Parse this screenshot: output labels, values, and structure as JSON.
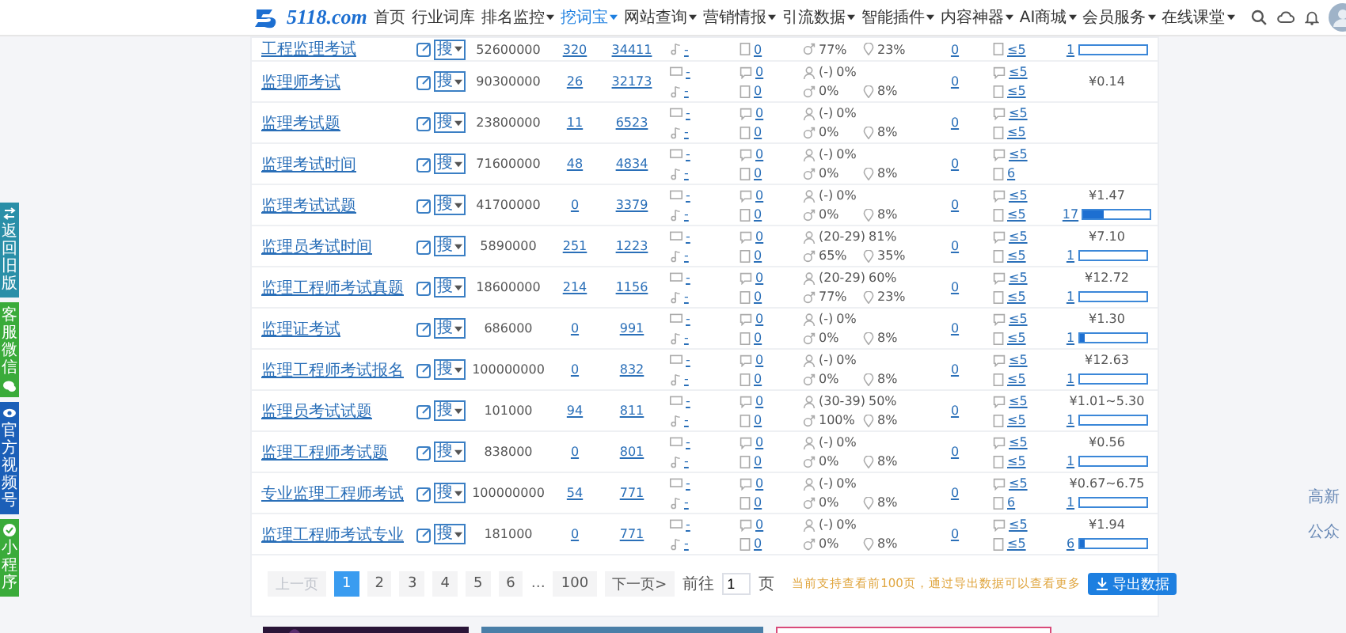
{
  "header": {
    "logo": "5118.com",
    "nav": [
      {
        "label": "首页",
        "dropdown": false,
        "selected": false
      },
      {
        "label": "行业词库",
        "dropdown": false,
        "selected": false
      },
      {
        "label": "排名监控",
        "dropdown": true,
        "selected": false
      },
      {
        "label": "挖词宝",
        "dropdown": true,
        "selected": true
      },
      {
        "label": "网站查询",
        "dropdown": true,
        "selected": false
      },
      {
        "label": "营销情报",
        "dropdown": true,
        "selected": false
      },
      {
        "label": "引流数据",
        "dropdown": true,
        "selected": false
      },
      {
        "label": "智能插件",
        "dropdown": true,
        "selected": false
      },
      {
        "label": "内容神器",
        "dropdown": true,
        "selected": false
      },
      {
        "label": "AI商城",
        "dropdown": true,
        "selected": false
      },
      {
        "label": "会员服务",
        "dropdown": true,
        "selected": false
      },
      {
        "label": "在线课堂",
        "dropdown": true,
        "selected": false
      }
    ]
  },
  "side_tabs": [
    {
      "label": "返回旧版",
      "color": "#2a8fa8",
      "kind": "back"
    },
    {
      "label": "客服微信",
      "color": "#3aab3a",
      "kind": "wechat"
    },
    {
      "label": "官方视频号",
      "color": "#1b5fb8",
      "kind": "video"
    },
    {
      "label": "小程序",
      "color": "#3aab3a",
      "kind": "miniapp"
    }
  ],
  "rows": [
    {
      "keyword": "工程监理考试",
      "tool": "搜",
      "index": "52600000",
      "col3": "320",
      "col4": "34411",
      "col8": "0",
      "bottom": {
        "col5": "-",
        "col6": "0",
        "male": "77%",
        "region": "23%",
        "col9": "≤5",
        "count": "1",
        "level": 0
      }
    },
    {
      "keyword": "监理师考试",
      "tool": "搜",
      "index": "90300000",
      "col3": "26",
      "col4": "32173",
      "col8": "0",
      "top": {
        "col5": "-",
        "col6": "0",
        "age": "(-)",
        "age_share": "0%",
        "col9": "≤5",
        "price": "¥0.14"
      },
      "bottom": {
        "col5": "-",
        "col6": "0",
        "male": "0%",
        "region": "8%",
        "col9": "≤5"
      }
    },
    {
      "keyword": "监理考试题",
      "tool": "搜",
      "index": "23800000",
      "col3": "11",
      "col4": "6523",
      "col8": "0",
      "top": {
        "col5": "-",
        "col6": "0",
        "age": "(-)",
        "age_share": "0%",
        "col9": "≤5"
      },
      "bottom": {
        "col5": "-",
        "col6": "0",
        "male": "0%",
        "region": "8%",
        "col9": "≤5"
      }
    },
    {
      "keyword": "监理考试时间",
      "tool": "搜",
      "index": "71600000",
      "col3": "48",
      "col4": "4834",
      "col8": "0",
      "top": {
        "col5": "-",
        "col6": "0",
        "age": "(-)",
        "age_share": "0%",
        "col9": "≤5"
      },
      "bottom": {
        "col5": "-",
        "col6": "0",
        "male": "0%",
        "region": "8%",
        "col9": "6"
      }
    },
    {
      "keyword": "监理考试试题",
      "tool": "搜",
      "index": "41700000",
      "col3": "0",
      "col4": "3379",
      "col8": "0",
      "top": {
        "col5": "-",
        "col6": "0",
        "age": "(-)",
        "age_share": "0%",
        "col9": "≤5",
        "price": "¥1.47"
      },
      "bottom": {
        "col5": "-",
        "col6": "0",
        "male": "0%",
        "region": "8%",
        "col9": "≤5",
        "count": "17",
        "level": 0.3
      }
    },
    {
      "keyword": "监理员考试时间",
      "tool": "搜",
      "index": "5890000",
      "col3": "251",
      "col4": "1223",
      "col8": "0",
      "top": {
        "col5": "-",
        "col6": "0",
        "age": "(20-29)",
        "age_share": "81%",
        "col9": "≤5",
        "price": "¥7.10"
      },
      "bottom": {
        "col5": "-",
        "col6": "0",
        "male": "65%",
        "region": "35%",
        "col9": "≤5",
        "count": "1",
        "level": 0
      }
    },
    {
      "keyword": "监理工程师考试真题",
      "tool": "搜",
      "index": "18600000",
      "col3": "214",
      "col4": "1156",
      "col8": "0",
      "top": {
        "col5": "-",
        "col6": "0",
        "age": "(20-29)",
        "age_share": "60%",
        "col9": "≤5",
        "price": "¥12.72"
      },
      "bottom": {
        "col5": "-",
        "col6": "0",
        "male": "77%",
        "region": "23%",
        "col9": "≤5",
        "count": "1",
        "level": 0
      }
    },
    {
      "keyword": "监理证考试",
      "tool": "搜",
      "index": "686000",
      "col3": "0",
      "col4": "991",
      "col8": "0",
      "top": {
        "col5": "-",
        "col6": "0",
        "age": "(-)",
        "age_share": "0%",
        "col9": "≤5",
        "price": "¥1.30"
      },
      "bottom": {
        "col5": "-",
        "col6": "0",
        "male": "0%",
        "region": "8%",
        "col9": "≤5",
        "count": "1",
        "level": 0.08
      }
    },
    {
      "keyword": "监理工程师考试报名",
      "tool": "搜",
      "index": "100000000",
      "col3": "0",
      "col4": "832",
      "col8": "0",
      "top": {
        "col5": "-",
        "col6": "0",
        "age": "(-)",
        "age_share": "0%",
        "col9": "≤5",
        "price": "¥12.63"
      },
      "bottom": {
        "col5": "-",
        "col6": "0",
        "male": "0%",
        "region": "8%",
        "col9": "≤5",
        "count": "1",
        "level": 0
      }
    },
    {
      "keyword": "监理员考试试题",
      "tool": "搜",
      "index": "101000",
      "col3": "94",
      "col4": "811",
      "col8": "0",
      "top": {
        "col5": "-",
        "col6": "0",
        "age": "(30-39)",
        "age_share": "50%",
        "col9": "≤5",
        "price": "¥1.01~5.30"
      },
      "bottom": {
        "col5": "-",
        "col6": "0",
        "male": "100%",
        "region": "8%",
        "col9": "≤5",
        "count": "1",
        "level": 0
      }
    },
    {
      "keyword": "监理工程师考试题",
      "tool": "搜",
      "index": "838000",
      "col3": "0",
      "col4": "801",
      "col8": "0",
      "top": {
        "col5": "-",
        "col6": "0",
        "age": "(-)",
        "age_share": "0%",
        "col9": "≤5",
        "price": "¥0.56"
      },
      "bottom": {
        "col5": "-",
        "col6": "0",
        "male": "0%",
        "region": "8%",
        "col9": "≤5",
        "count": "1",
        "level": 0
      }
    },
    {
      "keyword": "专业监理工程师考试",
      "tool": "搜",
      "index": "100000000",
      "col3": "54",
      "col4": "771",
      "col8": "0",
      "top": {
        "col5": "-",
        "col6": "0",
        "age": "(-)",
        "age_share": "0%",
        "col9": "≤5",
        "price": "¥0.67~6.75"
      },
      "bottom": {
        "col5": "-",
        "col6": "0",
        "male": "0%",
        "region": "8%",
        "col9": "6",
        "count": "1",
        "level": 0
      }
    },
    {
      "keyword": "监理工程师考试专业",
      "tool": "搜",
      "index": "181000",
      "col3": "0",
      "col4": "771",
      "col8": "0",
      "top": {
        "col5": "-",
        "col6": "0",
        "age": "(-)",
        "age_share": "0%",
        "col9": "≤5",
        "price": "¥1.94"
      },
      "bottom": {
        "col5": "-",
        "col6": "0",
        "male": "0%",
        "region": "8%",
        "col9": "≤5",
        "count": "6",
        "level": 0.08
      }
    }
  ],
  "pagination": {
    "prev": {
      "label": "上一页",
      "disabled": true
    },
    "pages": [
      {
        "label": "1",
        "selected": true
      },
      {
        "label": "2",
        "selected": false
      },
      {
        "label": "3",
        "selected": false
      },
      {
        "label": "4",
        "selected": false
      },
      {
        "label": "5",
        "selected": false
      },
      {
        "label": "6",
        "selected": false
      }
    ],
    "ellipsis": "…",
    "last": "100",
    "next": {
      "label": "下一页>",
      "disabled": false
    },
    "goto_label": "前往",
    "goto_value": "1",
    "goto_unit": "页",
    "note": "当前支持查看前100页，通过导出数据可以查看更多",
    "export": "导出数据"
  },
  "right_texts": [
    "高新",
    "公众"
  ]
}
